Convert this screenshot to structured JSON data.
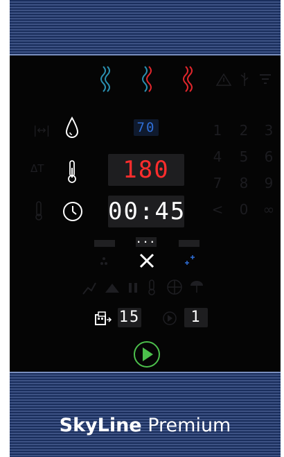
{
  "brand": {
    "name": "SkyLine",
    "edition": "Premium"
  },
  "displays": {
    "humidity": "70",
    "temperature": "180",
    "time": "00:45",
    "program": "15",
    "step": "1",
    "fan_indicator": "..."
  },
  "keypad": {
    "keys": [
      "1",
      "2",
      "3",
      "4",
      "5",
      "6",
      "7",
      "8",
      "9",
      "<",
      "0",
      "∞"
    ]
  },
  "colors": {
    "steam_blue": "#2a8fb0",
    "heat_red": "#e0262c",
    "display_red": "#ff2d2d",
    "display_white": "#ffffff",
    "display_blue": "#2f6fd8",
    "start_green": "#4cc04c"
  }
}
